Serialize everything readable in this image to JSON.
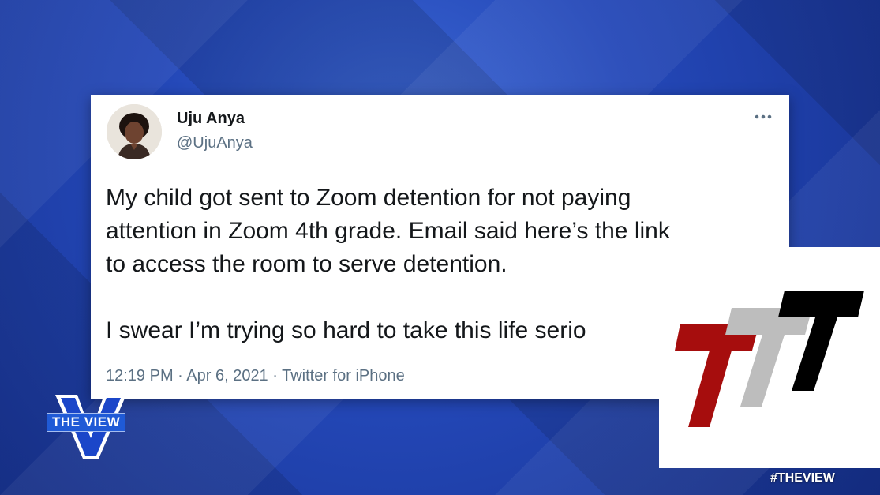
{
  "tweet": {
    "author_name": "Uju Anya",
    "author_handle": "@UjuAnya",
    "more_icon": "more-options-icon",
    "body_paragraphs": [
      "My child got sent to Zoom detention for not paying\nattention in Zoom 4th grade. Email said here’s the link\nto access the room to serve detention.",
      "I swear I’m trying so hard to take this life serio"
    ],
    "timestamp": "12:19 PM · Apr 6, 2021 · Twitter for iPhone"
  },
  "overlay_logo": {
    "icon": "three-t-logo",
    "colors": [
      "#a60d0d",
      "#bdbdbd",
      "#000000"
    ]
  },
  "show_branding": {
    "logo_label": "THE VIEW",
    "hashtag": "#THEVIEW"
  },
  "colors": {
    "background": "#1f3fa8",
    "card": "#ffffff",
    "text_primary": "#14171a",
    "text_secondary": "#5b7083"
  }
}
